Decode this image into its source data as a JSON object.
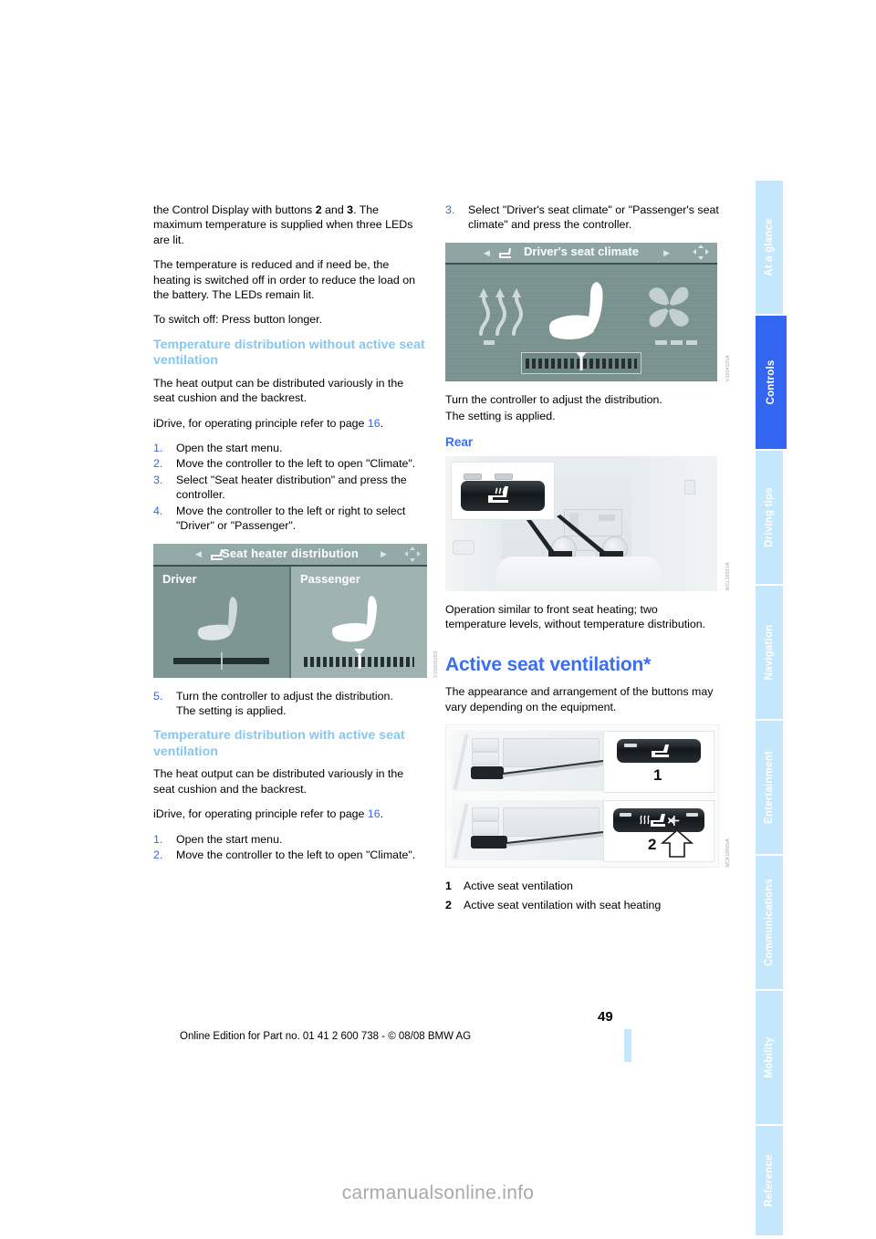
{
  "sidebar": {
    "tabs": [
      {
        "label": "At a glance",
        "active": false
      },
      {
        "label": "Controls",
        "active": true
      },
      {
        "label": "Driving tips",
        "active": false
      },
      {
        "label": "Navigation",
        "active": false
      },
      {
        "label": "Entertainment",
        "active": false
      },
      {
        "label": "Communications",
        "active": false
      },
      {
        "label": "Mobility",
        "active": false
      },
      {
        "label": "Reference",
        "active": false
      }
    ],
    "active_color": "#3366f0",
    "inactive_color": "#c5e7fb"
  },
  "left_column": {
    "para1": "the Control Display with buttons 2 and 3. The maximum temperature is supplied when three LEDs are lit.",
    "para1_parts": {
      "a": "the Control Display with buttons ",
      "b1": "2",
      "c": " and ",
      "b2": "3",
      "d": ". The maximum temperature is supplied when three LEDs are lit."
    },
    "para2": "The temperature is reduced and if need be, the heating is switched off in order to reduce the load on the battery. The LEDs remain lit.",
    "para3": "To switch off: Press button longer.",
    "heading1": "Temperature distribution without active seat ventilation",
    "para4": "The heat output can be distributed variously in the seat cushion and the backrest.",
    "idrive_ref_a": "iDrive, for operating principle refer to page ",
    "idrive_ref_page": "16",
    "idrive_ref_b": ".",
    "steps_a": [
      {
        "num": "1.",
        "text": "Open the start menu."
      },
      {
        "num": "2.",
        "text": "Move the controller to the left to open \"Climate\"."
      },
      {
        "num": "3.",
        "text": "Select \"Seat heater distribution\" and press the controller."
      },
      {
        "num": "4.",
        "text": "Move the controller to the left or right to select \"Driver\" or \"Passenger\"."
      }
    ],
    "figure_seat_heater": {
      "title": "Seat heater distribution",
      "left_label": "Driver",
      "right_label": "Passenger",
      "code": "V100010DS"
    },
    "step5": {
      "num": "5.",
      "text": "Turn the controller to adjust the distribution.",
      "sub": "The setting is applied."
    },
    "heading2": "Temperature distribution with active seat ventilation",
    "para5": "The heat output can be distributed variously in the seat cushion and the backrest.",
    "steps_b": [
      {
        "num": "1.",
        "text": "Open the start menu."
      },
      {
        "num": "2.",
        "text": "Move the controller to the left to open \"Climate\"."
      }
    ]
  },
  "right_column": {
    "step3": {
      "num": "3.",
      "text": "Select \"Driver's seat climate\" or \"Passenger's seat climate\" and press the controller."
    },
    "figure_climate": {
      "title": "Driver's seat climate",
      "code": "V100433VA"
    },
    "para1": "Turn the controller to adjust the distribution.",
    "para1b": "The setting is applied.",
    "heading_rear": "Rear",
    "figure_rear": {
      "code": "WCL1891VA"
    },
    "para2": "Operation similar to front seat heating; two temperature levels, without temperature distribution.",
    "heading_main": "Active seat ventilation*",
    "para3": "The appearance and arrangement of the buttons may vary depending on the equipment.",
    "figure_buttons": {
      "callout1": "1",
      "callout2": "2",
      "code": "WCK0958VA"
    },
    "legend": [
      {
        "num": "1",
        "text": "Active seat ventilation"
      },
      {
        "num": "2",
        "text": "Active seat ventilation with seat heating"
      }
    ]
  },
  "footer": {
    "page_number": "49",
    "edition": "Online Edition for Part no. 01 41 2 600 738 - © 08/08 BMW AG"
  },
  "watermark": "carmanualsonline.info"
}
